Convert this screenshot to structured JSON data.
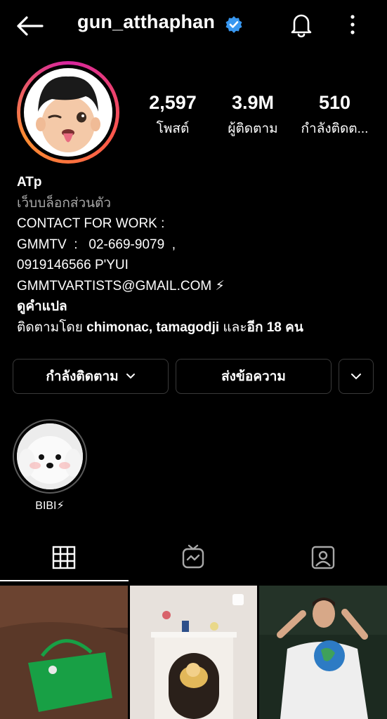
{
  "header": {
    "username": "gun_atthaphan"
  },
  "stats": [
    {
      "value": "2,597",
      "label": "โพสต์"
    },
    {
      "value": "3.9M",
      "label": "ผู้ติดตาม"
    },
    {
      "value": "510",
      "label": "กำลังติดต..."
    }
  ],
  "bio": {
    "name": "ATp",
    "category": "เว็บบล็อกส่วนตัว",
    "lines": [
      "CONTACT FOR WORK :",
      "GMMTV  :   02-669-9079  ,",
      "0919146566 P'YUI",
      "GMMTVARTISTS@GMAIL.COM ⚡"
    ],
    "translate": "ดูคำแปล",
    "followed_prefix": "ติดตามโดย ",
    "followed_names": "chimonac, tamagodji",
    "followed_mid": " และ",
    "followed_count": "อีก 18 คน"
  },
  "buttons": {
    "following": "กำลังติดตาม",
    "message": "ส่งข้อความ"
  },
  "highlights": [
    {
      "label": "BIBI⚡"
    }
  ],
  "tabs": [
    "posts-grid",
    "igtv",
    "tagged"
  ],
  "colors": {
    "verified": "#3897f0",
    "background": "#000000",
    "muted": "#a8a8a8"
  }
}
